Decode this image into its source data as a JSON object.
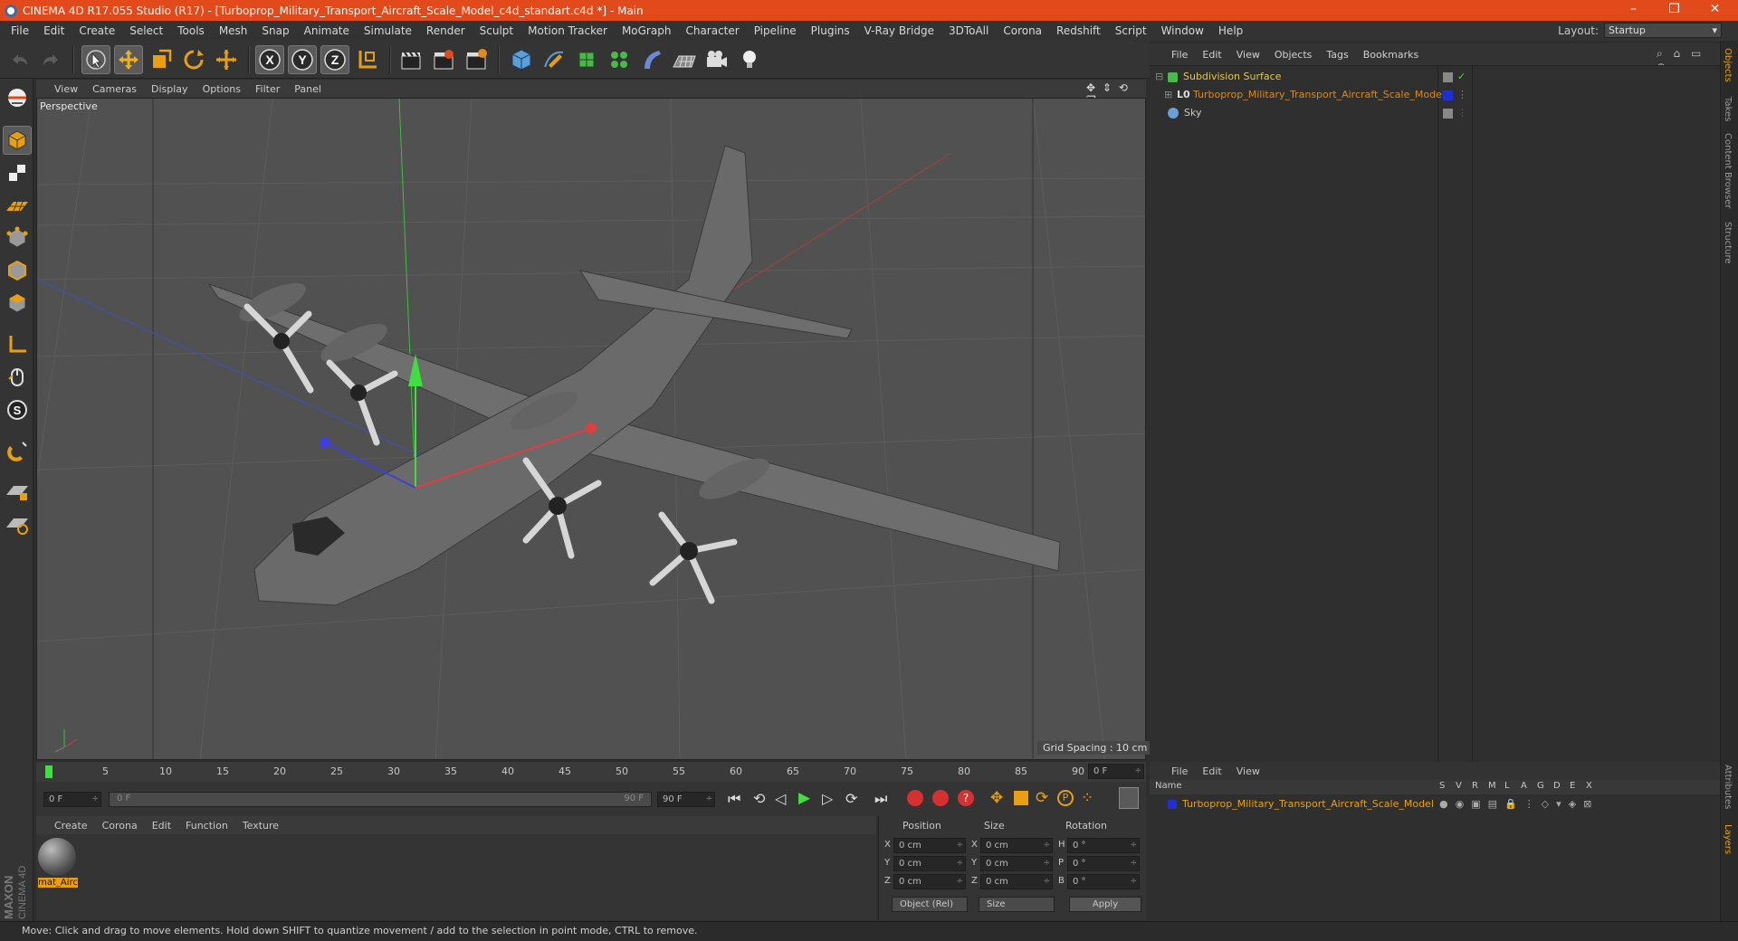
{
  "window": {
    "title": "CINEMA 4D R17.055 Studio (R17) - [Turboprop_Military_Transport_Aircraft_Scale_Model_c4d_standart.c4d *] - Main",
    "controls": [
      "–",
      "❐",
      "✕"
    ]
  },
  "menubar": {
    "items": [
      "File",
      "Edit",
      "Create",
      "Select",
      "Tools",
      "Mesh",
      "Snap",
      "Animate",
      "Simulate",
      "Render",
      "Sculpt",
      "Motion Tracker",
      "MoGraph",
      "Character",
      "Pipeline",
      "Plugins",
      "V-Ray Bridge",
      "3DToAll",
      "Corona",
      "Redshift",
      "Script",
      "Window",
      "Help"
    ],
    "layout_label": "Layout:",
    "layout_value": "Startup"
  },
  "viewport": {
    "menu": [
      "View",
      "Cameras",
      "Display",
      "Options",
      "Filter",
      "Panel"
    ],
    "label": "Perspective",
    "grid_spacing": "Grid Spacing : 10 cm"
  },
  "timeline": {
    "ticks": [
      "0",
      "5",
      "10",
      "15",
      "20",
      "25",
      "30",
      "35",
      "40",
      "45",
      "50",
      "55",
      "60",
      "65",
      "70",
      "75",
      "80",
      "85",
      "90"
    ],
    "current_frame": "0 F",
    "start_frame": "0 F",
    "slider_start": "0 F",
    "slider_end": "90 F",
    "end_frame": "90 F"
  },
  "material_manager": {
    "menu": [
      "Create",
      "Corona",
      "Edit",
      "Function",
      "Texture"
    ],
    "material_name": "mat_Airc"
  },
  "coordinates": {
    "headers": [
      "Position",
      "Size",
      "Rotation"
    ],
    "rows": [
      {
        "axis": "X",
        "pos": "0 cm",
        "size_axis": "X",
        "size": "0 cm",
        "rot_axis": "H",
        "rot": "0 °"
      },
      {
        "axis": "Y",
        "pos": "0 cm",
        "size_axis": "Y",
        "size": "0 cm",
        "rot_axis": "P",
        "rot": "0 °"
      },
      {
        "axis": "Z",
        "pos": "0 cm",
        "size_axis": "Z",
        "size": "0 cm",
        "rot_axis": "B",
        "rot": "0 °"
      }
    ],
    "mode": "Object (Rel)",
    "size_mode": "Size",
    "apply": "Apply"
  },
  "object_manager": {
    "menu": [
      "File",
      "Edit",
      "View",
      "Objects",
      "Tags",
      "Bookmarks"
    ],
    "objects": [
      {
        "name": "Subdivision Surface",
        "color": "#e6c84a"
      },
      {
        "name": "Turboprop_Military_Transport_Aircraft_Scale_Model",
        "color": "#d88a22"
      },
      {
        "name": "Sky",
        "color": "#c8c8c8"
      }
    ]
  },
  "layer_manager": {
    "menu": [
      "File",
      "Edit",
      "View"
    ],
    "columns": [
      "Name",
      "S",
      "V",
      "R",
      "M",
      "L",
      "A",
      "G",
      "D",
      "E",
      "X"
    ],
    "rows": [
      "Turboprop_Military_Transport_Aircraft_Scale_Model"
    ]
  },
  "side_tabs": [
    "Objects",
    "Takes",
    "Content Browser",
    "Structure"
  ],
  "side_tabs_bottom": [
    "Attributes",
    "Layers"
  ],
  "status": "Move: Click and drag to move elements. Hold down SHIFT to quantize movement / add to the selection in point mode, CTRL to remove.",
  "logo_text": [
    "MAXON",
    "CINEMA 4D"
  ],
  "colors": {
    "accent": "#e24a1c",
    "selection": "#d88a22"
  }
}
